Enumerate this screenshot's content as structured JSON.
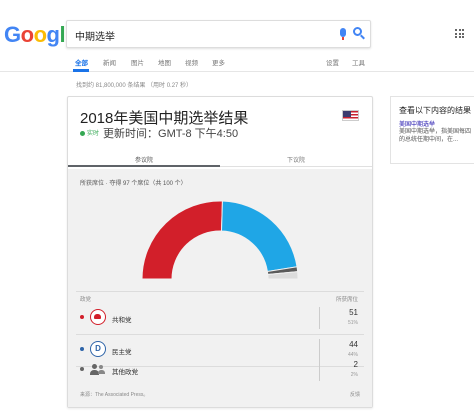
{
  "header": {
    "logo_letters": [
      {
        "ch": "G",
        "color": "#4285f4"
      },
      {
        "ch": "o",
        "color": "#ea4335"
      },
      {
        "ch": "o",
        "color": "#fbbc05"
      },
      {
        "ch": "g",
        "color": "#4285f4"
      },
      {
        "ch": "l",
        "color": "#34a853"
      },
      {
        "ch": "e",
        "color": "#ea4335"
      }
    ],
    "search_query": "中期选举",
    "mic_icon": "mic-icon",
    "search_icon": "search-icon",
    "apps_icon": "apps-grid-icon"
  },
  "tabs": {
    "all": "全部",
    "news": "新闻",
    "images": "图片",
    "maps": "地图",
    "videos": "视频",
    "more": "更多",
    "settings": "设置",
    "tools": "工具"
  },
  "stats": "找到约 81,800,000 条结果 （用时 0.27 秒）",
  "card": {
    "title": "2018年美国中期选举结果",
    "live_label": "实时",
    "updated": "更新时间：GMT-8 下午4:50",
    "flag_icon": "us-flag-icon",
    "tab_senate": "参议院",
    "tab_house": "下议院",
    "seats_summary": "所获席位 · 夺得 97 个席位（共 100 个）",
    "col_party": "政党",
    "col_seats": "所获席位",
    "source": "来源：The Associated Press。",
    "feedback": "反馈"
  },
  "chart_data": {
    "type": "pie",
    "subtype": "half-donut",
    "total_seats": 100,
    "won_seats": 97,
    "slices": [
      {
        "name": "共和党",
        "value": 51,
        "color": "#d21f2a"
      },
      {
        "name": "民主党",
        "value": 44,
        "color": "#1fa6e6"
      },
      {
        "name": "其他政党",
        "value": 2,
        "color": "#5a5a5a"
      },
      {
        "name": "",
        "value": 3,
        "color": "#dcdcdc"
      }
    ]
  },
  "parties": [
    {
      "name": "共和党",
      "seats": "51",
      "pct": "51%",
      "color": "#d21f2a",
      "icon": "republican-elephant-icon"
    },
    {
      "name": "民主党",
      "seats": "44",
      "pct": "44%",
      "color": "#2e64a8",
      "icon": "democrat-d-icon",
      "icon_glyph": "D"
    },
    {
      "name": "其他政党",
      "seats": "2",
      "pct": "2%",
      "color": "#666666",
      "icon": "people-icon"
    }
  ],
  "side_panel": {
    "title": "查看以下内容的结果",
    "link": "美国中期选举",
    "snippet_1": "美国中期选举，指美国每四",
    "snippet_2": "的总统任期中间，在..."
  }
}
